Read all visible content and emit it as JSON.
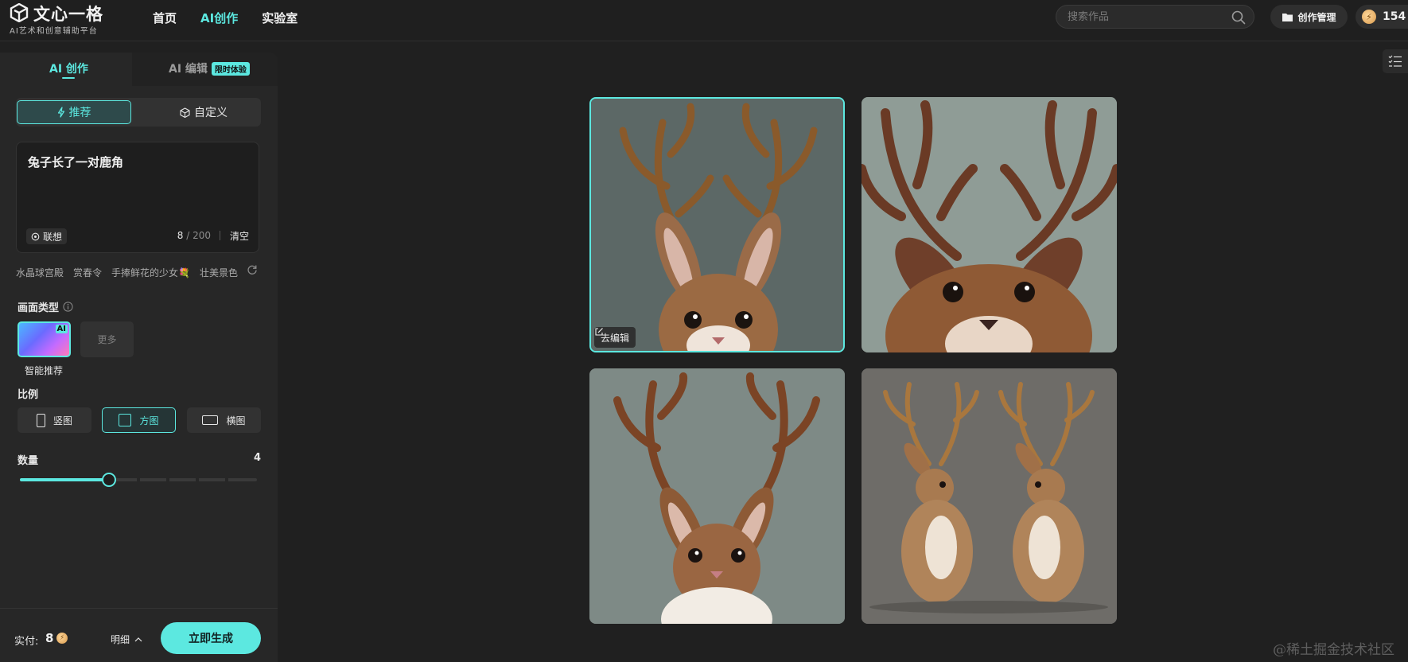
{
  "brand": {
    "title": "文心一格",
    "subtitle": "AI艺术和创意辅助平台"
  },
  "nav": [
    {
      "label": "首页",
      "active": false
    },
    {
      "label": "AI创作",
      "active": true
    },
    {
      "label": "实验室",
      "active": false
    }
  ],
  "search": {
    "placeholder": "搜索作品",
    "icon": "search-icon"
  },
  "header": {
    "manage_label": "创作管理",
    "points": "154"
  },
  "tabs": {
    "create": "AI 创作",
    "edit": "AI 编辑",
    "edit_badge": "限时体验"
  },
  "mode": {
    "recommend": "推荐",
    "custom": "自定义"
  },
  "prompt": {
    "text": "兔子长了一对鹿角",
    "associate": "联想",
    "count": "8",
    "max": "200",
    "separator": "/",
    "clear": "清空"
  },
  "suggestions": [
    "水晶球宫殿",
    "赏春令",
    "手捧鲜花的少女💐",
    "壮美景色"
  ],
  "picture_type": {
    "label": "画面类型",
    "card_tag": "AI",
    "card_caption": "智能推荐",
    "more": "更多"
  },
  "ratio": {
    "label": "比例",
    "options": [
      {
        "label": "竖图",
        "selected": false
      },
      {
        "label": "方图",
        "selected": true
      },
      {
        "label": "横图",
        "selected": false
      }
    ]
  },
  "quantity": {
    "label": "数量",
    "value": "4",
    "level": 0.375
  },
  "footer": {
    "pay_label": "实付:",
    "pay_value": "8",
    "detail": "明细",
    "generate": "立即生成"
  },
  "gallery": {
    "edit_chip": "去编辑"
  },
  "watermark": "@稀土掘金技术社区",
  "colors": {
    "accent": "#5ce8e0",
    "background": "#202020",
    "panel": "#272727"
  }
}
